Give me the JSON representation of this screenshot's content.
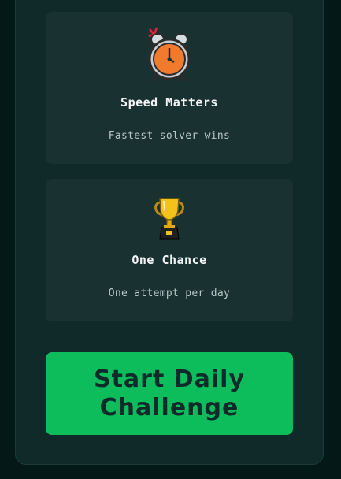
{
  "cards": [
    {
      "icon": "alarm-clock-icon",
      "title": "Speed Matters",
      "description": "Fastest solver wins"
    },
    {
      "icon": "trophy-icon",
      "title": "One Chance",
      "description": "One attempt per day"
    }
  ],
  "start_button": {
    "label": "Start Daily Challenge"
  },
  "colors": {
    "background": "#041817",
    "panel": "#102a2a",
    "card": "#1a3132",
    "accent": "#0dbd5c",
    "button_text": "#0c2b2a"
  }
}
